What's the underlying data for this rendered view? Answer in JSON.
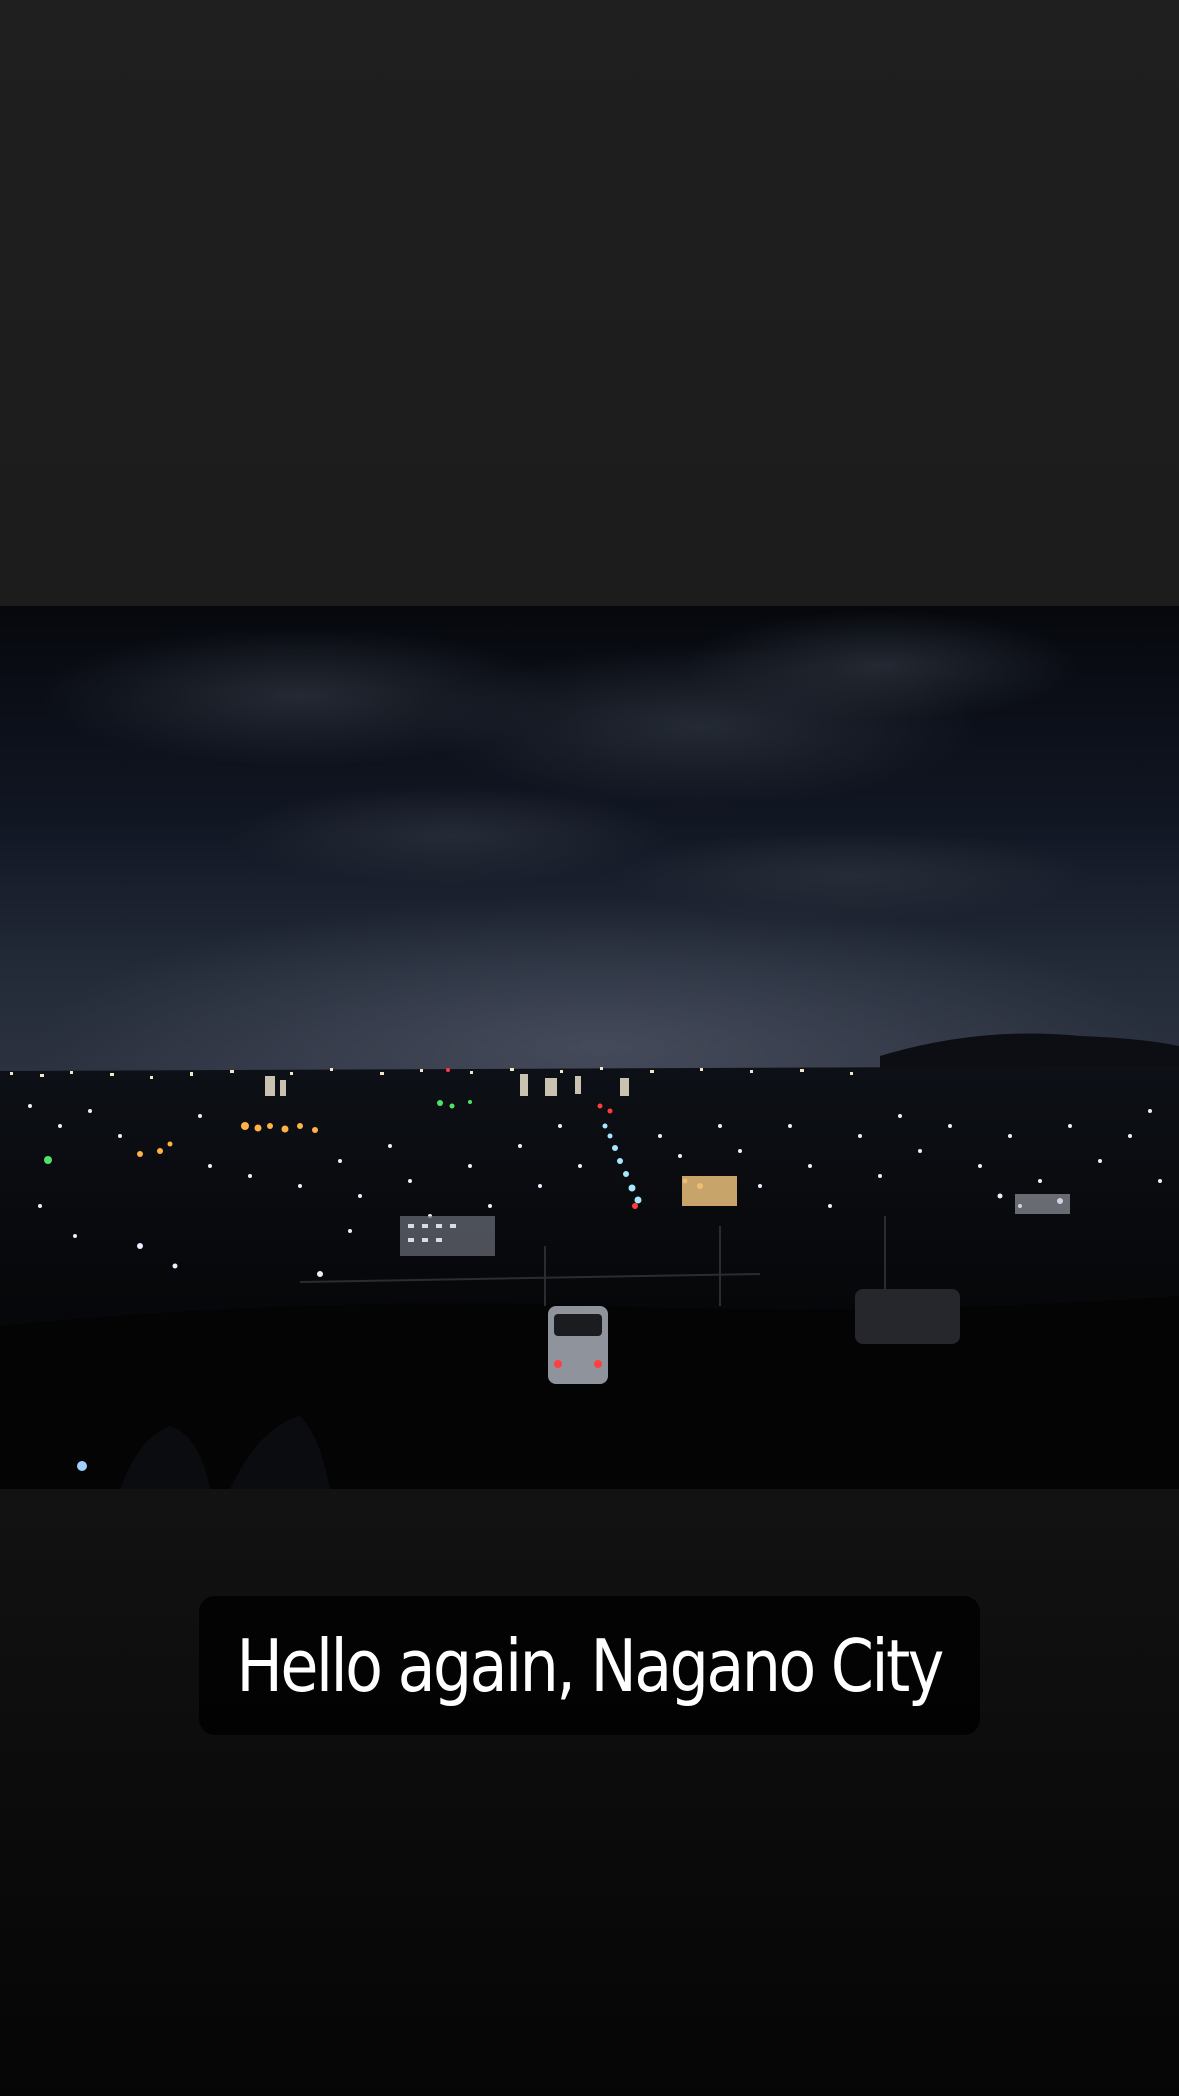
{
  "story": {
    "background_top": "#1f1f1f",
    "background_bottom": "#050505"
  },
  "photo": {
    "subject": "night-city-skyline"
  },
  "caption": {
    "text": "Hello again, Nagano City",
    "text_color": "#ffffff",
    "box_color": "#000000"
  }
}
